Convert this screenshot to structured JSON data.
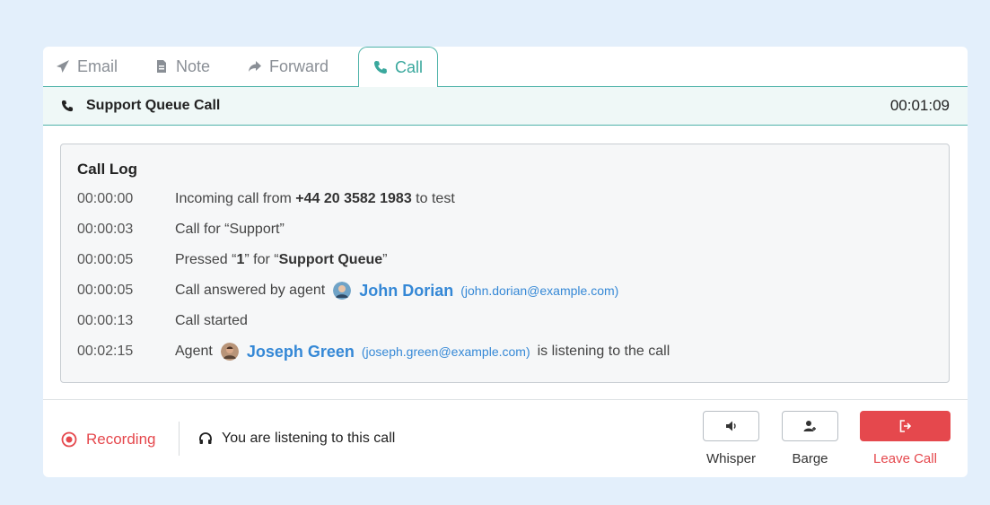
{
  "tabs": [
    {
      "label": "Email",
      "icon": "send-icon"
    },
    {
      "label": "Note",
      "icon": "note-icon"
    },
    {
      "label": "Forward",
      "icon": "forward-icon"
    },
    {
      "label": "Call",
      "icon": "phone-icon",
      "active": true
    }
  ],
  "call": {
    "title": "Support Queue Call",
    "timer": "00:01:09"
  },
  "log": {
    "title": "Call Log",
    "rows": [
      {
        "time": "00:00:00",
        "pre": "Incoming call from ",
        "bold": "+44 20 3582 1983",
        "post": " to test"
      },
      {
        "time": "00:00:03",
        "text": "Call for “Support”"
      },
      {
        "time": "00:00:05",
        "p1": "Pressed “",
        "b1": "1",
        "p2": "” for “",
        "b2": "Support Queue",
        "p3": "”"
      },
      {
        "time": "00:00:05",
        "pre": "Call answered by agent",
        "agent": "John Dorian",
        "email": "(john.dorian@example.com)"
      },
      {
        "time": "00:00:13",
        "text": "Call started"
      },
      {
        "time": "00:02:15",
        "pre": "Agent",
        "agent": "Joseph Green",
        "email": "(joseph.green@example.com)",
        "post": "is listening to the call"
      }
    ]
  },
  "footer": {
    "recording": "Recording",
    "listening": "You are listening to this call",
    "actions": [
      {
        "label": "Whisper",
        "icon": "speaker-icon"
      },
      {
        "label": "Barge",
        "icon": "user-plus-icon"
      },
      {
        "label": "Leave Call",
        "icon": "exit-icon"
      }
    ]
  },
  "colors": {
    "accent": "#3aa89d",
    "link": "#3588d6",
    "danger": "#e5484d",
    "background": "#e3effb"
  }
}
